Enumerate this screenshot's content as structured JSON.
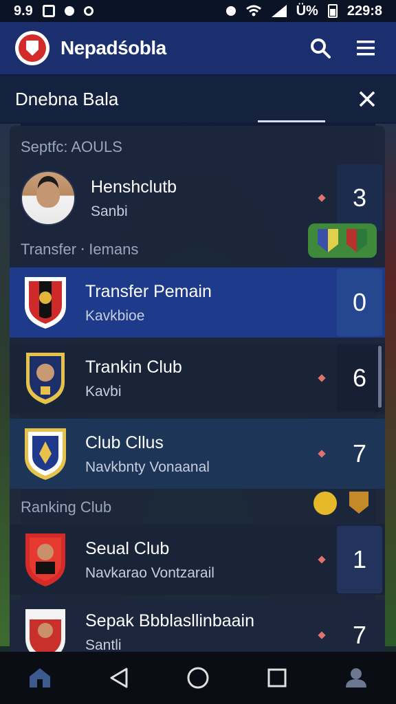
{
  "status": {
    "time_left": "9.9",
    "time_right": "229:8",
    "battery_text": "Ü%"
  },
  "app": {
    "title": "Nepadśobla"
  },
  "subheader": {
    "title": "Dnebna Bala"
  },
  "panel": {
    "section1": "Septfc: AOULS",
    "top_player": {
      "name": "Henshclutb",
      "sub": "Sanbi",
      "rank": "3"
    },
    "section2": "Transfer ⸱ Iemans",
    "rows": [
      {
        "title": "Transfer Pemain",
        "sub": "Kavkbioe",
        "rank": "0"
      },
      {
        "title": "Trankin Club",
        "sub": "Kavbi",
        "rank": "6"
      },
      {
        "title": "Club Cllus",
        "sub": "Navkbnty Vonaanal",
        "rank": "7"
      }
    ],
    "section3": "Ranking Club",
    "rows2": [
      {
        "title": "Seual Club",
        "sub": "Navkarao Vontzarail",
        "rank": "1"
      },
      {
        "title": "Sepak Bbblasllinbaain",
        "sub": "Santli",
        "rank": "7"
      }
    ]
  },
  "colors": {
    "appbar": "#1b2f6e",
    "highlight": "#1e3a8a",
    "accent_red": "#d42a2a",
    "badge_green": "#3f8a3a"
  },
  "icons": [
    "search-icon",
    "menu-icon",
    "close-icon",
    "home-icon",
    "back-icon",
    "home-circle-icon",
    "recents-icon",
    "profile-icon"
  ]
}
